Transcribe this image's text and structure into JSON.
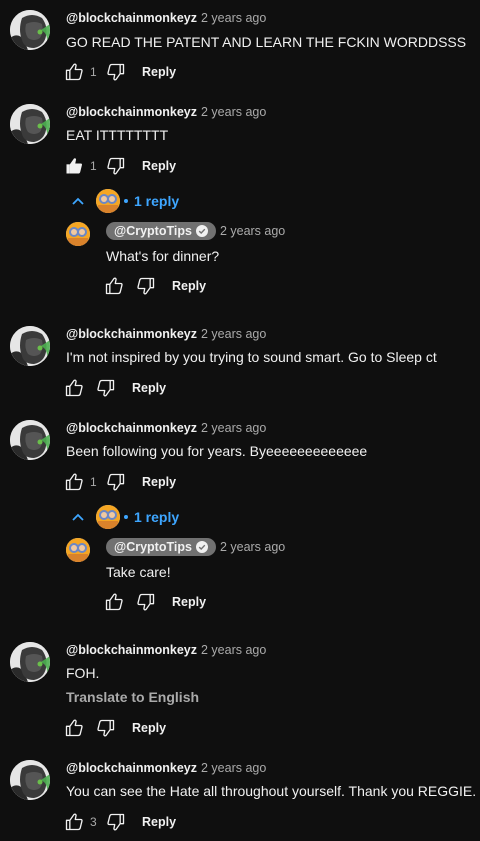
{
  "comments": [
    {
      "author": "@blockchainmonkeyz",
      "time": "2 years ago",
      "text": "GO READ THE PATENT AND LEARN THE FCKIN WORDDSSS",
      "likes": "1",
      "reply_label": "Reply"
    },
    {
      "author": "@blockchainmonkeyz",
      "time": "2 years ago",
      "text": "EAT ITTTTTTTT",
      "likes": "1",
      "reply_label": "Reply"
    },
    {
      "author": "@blockchainmonkeyz",
      "time": "2 years ago",
      "text": "I'm not inspired by you trying to sound smart.  Go to Sleep ct",
      "likes": "",
      "reply_label": "Reply"
    },
    {
      "author": "@blockchainmonkeyz",
      "time": "2 years ago",
      "text": "Been following you for years.  Byeeeeeeeeeeeee",
      "likes": "1",
      "reply_label": "Reply"
    },
    {
      "author": "@blockchainmonkeyz",
      "time": "2 years ago",
      "text": "FOH.",
      "translate": "Translate to English",
      "likes": "",
      "reply_label": "Reply"
    },
    {
      "author": "@blockchainmonkeyz",
      "time": "2 years ago",
      "text": "You can see the Hate all throughout yourself.  Thank you REGGIE.",
      "likes": "3",
      "reply_label": "Reply"
    }
  ],
  "replies": [
    {
      "toggle": "1 reply",
      "author": "@CryptoTips",
      "time": "2 years ago",
      "text": "What's for dinner?",
      "reply_label": "Reply"
    },
    {
      "toggle": "1 reply",
      "author": "@CryptoTips",
      "time": "2 years ago",
      "text": "Take care!",
      "reply_label": "Reply"
    }
  ],
  "colors": {
    "background": "#0f0f0f",
    "link": "#3ea6ff",
    "secondary": "#aaaaaa"
  }
}
